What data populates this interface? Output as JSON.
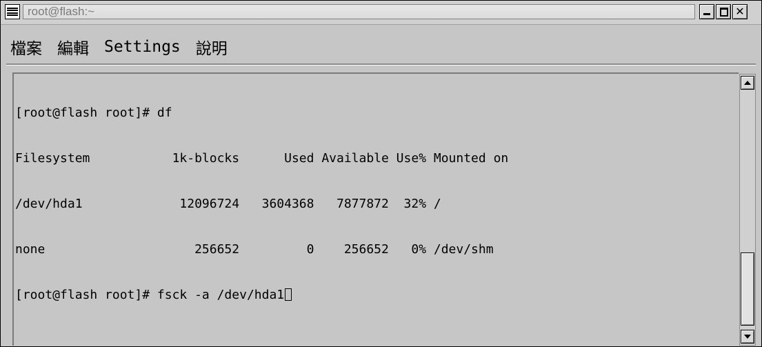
{
  "window": {
    "title": "root@flash:~"
  },
  "menu": {
    "file": "檔案",
    "edit": "編輯",
    "settings": "Settings",
    "help": "說明"
  },
  "terminal": {
    "lines": [
      "[root@flash root]# df",
      "Filesystem           1k-blocks      Used Available Use% Mounted on",
      "/dev/hda1             12096724   3604368   7877872  32% /",
      "none                    256652         0    256652   0% /dev/shm",
      "[root@flash root]# fsck -a /dev/hda1"
    ],
    "scroll_position": 1.0
  },
  "icons": [
    "window-menu-icon",
    "minimize-icon",
    "maximize-icon",
    "close-icon",
    "scroll-up-arrow-icon",
    "scroll-down-arrow-icon",
    "cursor-icon"
  ]
}
